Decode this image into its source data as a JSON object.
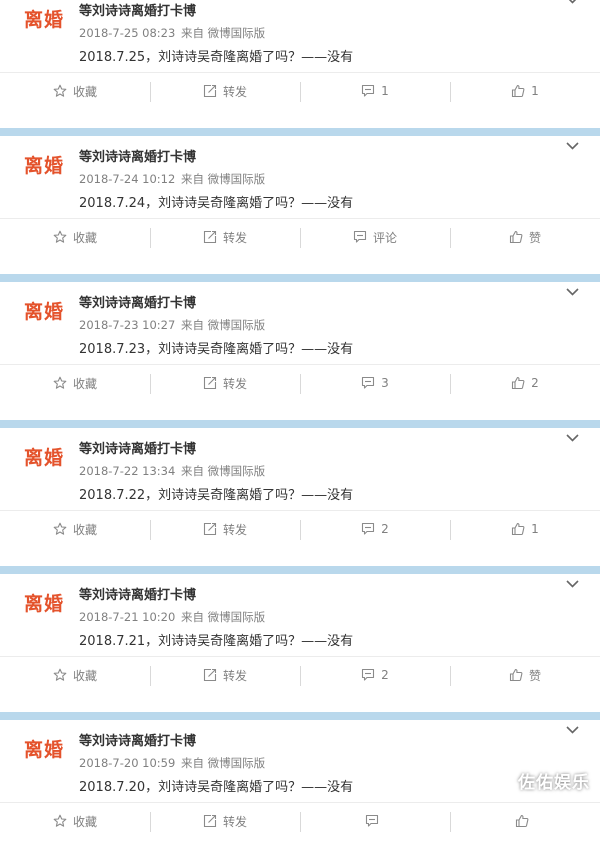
{
  "posts": [
    {
      "avatar_text": "离婚",
      "username": "等刘诗诗离婚打卡博",
      "time": "2018-7-25 08:23",
      "source": "来自 微博国际版",
      "text": "2018.7.25，刘诗诗吴奇隆离婚了吗？——没有",
      "favorite_label": "收藏",
      "repost_label": "转发",
      "comment_label": "1",
      "like_label": "1"
    },
    {
      "avatar_text": "离婚",
      "username": "等刘诗诗离婚打卡博",
      "time": "2018-7-24 10:12",
      "source": "来自 微博国际版",
      "text": "2018.7.24，刘诗诗吴奇隆离婚了吗？——没有",
      "favorite_label": "收藏",
      "repost_label": "转发",
      "comment_label": "评论",
      "like_label": "赞"
    },
    {
      "avatar_text": "离婚",
      "username": "等刘诗诗离婚打卡博",
      "time": "2018-7-23 10:27",
      "source": "来自 微博国际版",
      "text": "2018.7.23，刘诗诗吴奇隆离婚了吗？——没有",
      "favorite_label": "收藏",
      "repost_label": "转发",
      "comment_label": "3",
      "like_label": "2"
    },
    {
      "avatar_text": "离婚",
      "username": "等刘诗诗离婚打卡博",
      "time": "2018-7-22 13:34",
      "source": "来自 微博国际版",
      "text": "2018.7.22，刘诗诗吴奇隆离婚了吗？——没有",
      "favorite_label": "收藏",
      "repost_label": "转发",
      "comment_label": "2",
      "like_label": "1"
    },
    {
      "avatar_text": "离婚",
      "username": "等刘诗诗离婚打卡博",
      "time": "2018-7-21 10:20",
      "source": "来自 微博国际版",
      "text": "2018.7.21，刘诗诗吴奇隆离婚了吗？——没有",
      "favorite_label": "收藏",
      "repost_label": "转发",
      "comment_label": "2",
      "like_label": "赞"
    },
    {
      "avatar_text": "离婚",
      "username": "等刘诗诗离婚打卡博",
      "time": "2018-7-20 10:59",
      "source": "来自 微博国际版",
      "text": "2018.7.20，刘诗诗吴奇隆离婚了吗？——没有",
      "favorite_label": "收藏",
      "repost_label": "转发",
      "comment_label": "",
      "like_label": ""
    }
  ],
  "watermark": "佐佑娱乐",
  "colors": {
    "avatar_text": "#e4532c",
    "separator": "#b9d8ec",
    "icon": "#8a8a8a"
  },
  "icons": {
    "favorite": "star-icon",
    "repost": "share-icon",
    "comment": "comment-icon",
    "like": "thumbs-up-icon",
    "menu": "chevron-down-icon"
  }
}
